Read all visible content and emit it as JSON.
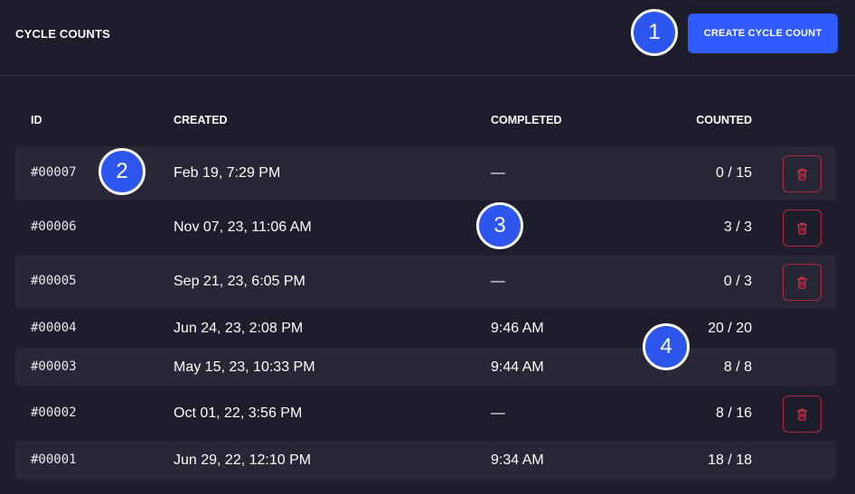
{
  "header": {
    "title": "CYCLE COUNTS",
    "create_label": "CREATE CYCLE COUNT"
  },
  "table": {
    "columns": {
      "id": "ID",
      "created": "CREATED",
      "completed": "COMPLETED",
      "counted": "COUNTED"
    },
    "rows": [
      {
        "id": "#00007",
        "created": "Feb 19, 7:29 PM",
        "completed": "—",
        "counted": "0 / 15",
        "deletable": true
      },
      {
        "id": "#00006",
        "created": "Nov 07, 23, 11:06 AM",
        "completed": "",
        "counted": "3 / 3",
        "deletable": true
      },
      {
        "id": "#00005",
        "created": "Sep 21, 23, 6:05 PM",
        "completed": "—",
        "counted": "0 / 3",
        "deletable": true
      },
      {
        "id": "#00004",
        "created": "Jun 24, 23, 2:08 PM",
        "completed": "9:46 AM",
        "counted": "20 / 20",
        "deletable": false
      },
      {
        "id": "#00003",
        "created": "May 15, 23, 10:33 PM",
        "completed": "9:44 AM",
        "counted": "8 / 8",
        "deletable": false
      },
      {
        "id": "#00002",
        "created": "Oct 01, 22, 3:56 PM",
        "completed": "—",
        "counted": "8 / 16",
        "deletable": true
      },
      {
        "id": "#00001",
        "created": "Jun 29, 22, 12:10 PM",
        "completed": "9:34 AM",
        "counted": "18 / 18",
        "deletable": false
      }
    ]
  },
  "markers": [
    "1",
    "2",
    "3",
    "4"
  ],
  "colors": {
    "background": "#1d1d2b",
    "row_alt": "#272736",
    "accent": "#2f5bff",
    "danger": "#b5283f",
    "marker": "#2d56ef"
  },
  "icons": {
    "delete": "trash-icon"
  }
}
